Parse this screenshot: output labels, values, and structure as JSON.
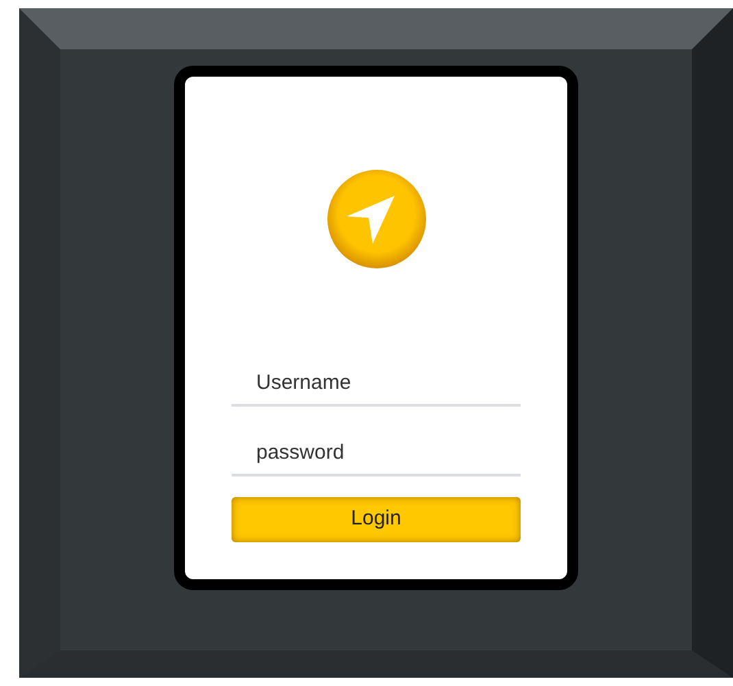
{
  "login_form": {
    "username": {
      "placeholder": "Username"
    },
    "password": {
      "placeholder": "password"
    },
    "login_button": "Login"
  }
}
